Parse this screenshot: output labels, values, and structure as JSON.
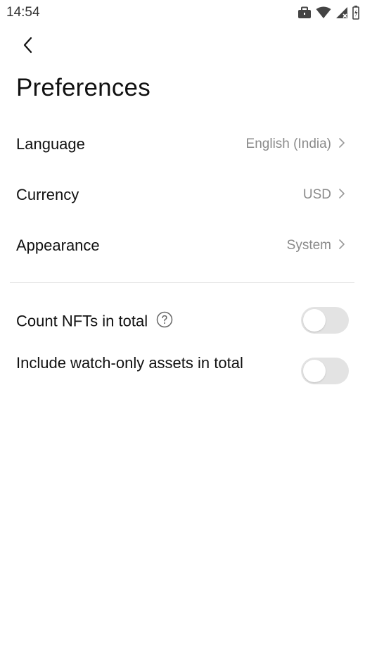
{
  "status_bar": {
    "time": "14:54",
    "icons": [
      "briefcase-icon",
      "wifi-icon",
      "cell-signal-icon",
      "battery-icon"
    ]
  },
  "header": {
    "back_icon": "chevron-left-icon",
    "title": "Preferences"
  },
  "settings": [
    {
      "label": "Language",
      "value": "English (India)"
    },
    {
      "label": "Currency",
      "value": "USD"
    },
    {
      "label": "Appearance",
      "value": "System"
    }
  ],
  "toggles": [
    {
      "label": "Count NFTs in total",
      "has_help": true,
      "enabled": false
    },
    {
      "label": "Include watch-only assets in total",
      "has_help": false,
      "enabled": false
    }
  ],
  "colors": {
    "value_text": "#8a8a8a",
    "switch_off": "#e3e3e3",
    "divider": "#e6e6e6"
  }
}
